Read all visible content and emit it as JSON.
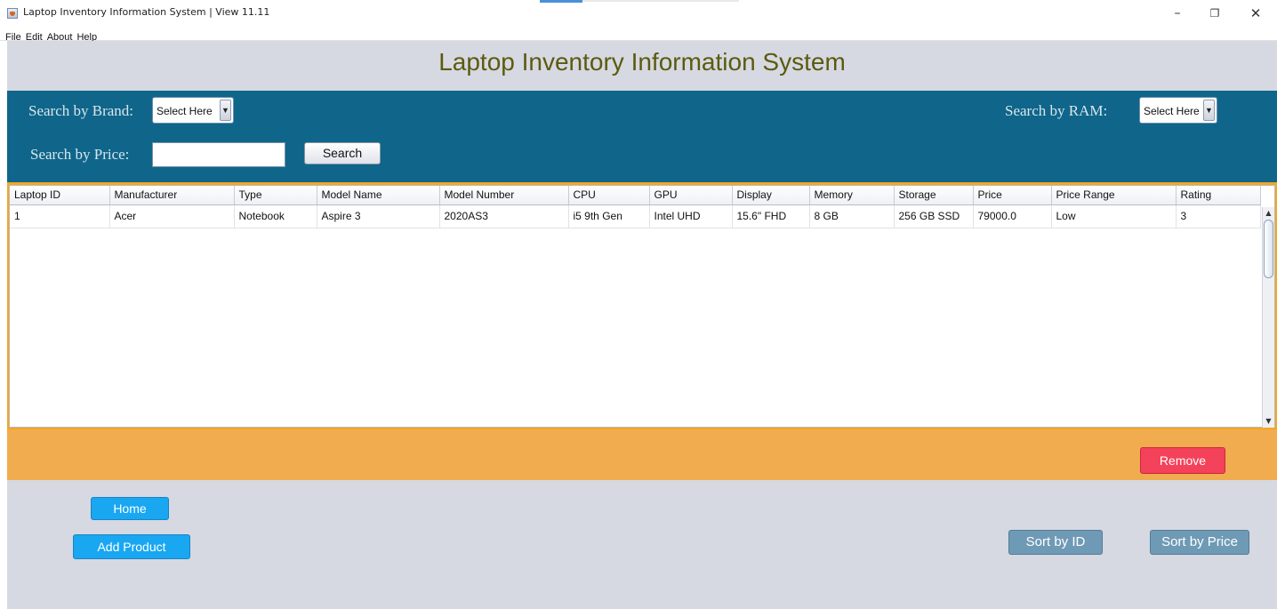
{
  "window": {
    "title": "Laptop Inventory Information System | View 11.11",
    "controls": {
      "minimize": "–",
      "maximize": "❐",
      "close": "✕"
    }
  },
  "menu": [
    "File",
    "Edit",
    "About",
    "Help"
  ],
  "header": {
    "title": "Laptop Inventory Information System"
  },
  "search": {
    "brand_label": "Search by Brand:",
    "brand_value": "Select Here",
    "ram_label": "Search by RAM:",
    "ram_value": "Select Here",
    "price_label": "Search by Price:",
    "price_value": "",
    "search_button": "Search"
  },
  "table": {
    "columns": [
      "Laptop ID",
      "Manufacturer",
      "Type",
      "Model Name",
      "Model Number",
      "CPU",
      "GPU",
      "Display",
      "Memory",
      "Storage",
      "Price",
      "Price Range",
      "Rating"
    ],
    "rows": [
      [
        "1",
        "Acer",
        "Notebook",
        "Aspire 3",
        "2020AS3",
        "i5 9th Gen",
        "Intel UHD",
        "15.6\" FHD",
        "8 GB",
        "256 GB SSD",
        "79000.0",
        "Low",
        "3"
      ]
    ]
  },
  "actions": {
    "remove": "Remove"
  },
  "footer": {
    "home": "Home",
    "add_product": "Add Product",
    "sort_by_id": "Sort by ID",
    "sort_by_price": "Sort by Price"
  },
  "colors": {
    "header_bg": "#d6d9e1",
    "search_bg": "#0f668a",
    "action_bg": "#f0ac4e",
    "remove_btn": "#f4425a",
    "primary_btn": "#19a7f2",
    "sort_btn": "#6f9ab5",
    "title_text": "#5c5a10"
  }
}
